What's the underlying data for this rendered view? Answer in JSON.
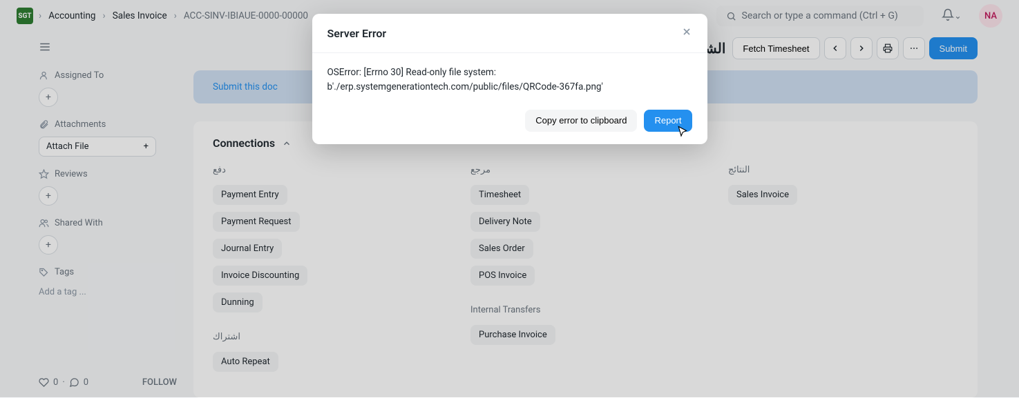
{
  "breadcrumb": {
    "items": [
      "Accounting",
      "Sales Invoice",
      "ACC-SINV-IBIAUE-0000-00000"
    ]
  },
  "search": {
    "placeholder": "Search or type a command (Ctrl + G)"
  },
  "avatar": {
    "initials": "NA"
  },
  "page": {
    "title": "الشركة السعودية الخليجية لحماية البيئة"
  },
  "actions": {
    "fetch_timesheet": "Fetch Timesheet",
    "submit": "Submit"
  },
  "banner": {
    "link_prefix": "Submit this doc"
  },
  "sidebar": {
    "assigned_to": "Assigned To",
    "attachments": "Attachments",
    "attach_file": "Attach File",
    "reviews": "Reviews",
    "shared_with": "Shared With",
    "tags": "Tags",
    "add_tag": "Add a tag ..."
  },
  "footer": {
    "likes": "0",
    "comments": "0",
    "follow": "FOLLOW"
  },
  "connections": {
    "title": "Connections",
    "cols": [
      {
        "title": "دفع",
        "chips": [
          "Payment Entry",
          "Payment Request",
          "Journal Entry",
          "Invoice Discounting",
          "Dunning"
        ],
        "sub": {
          "title": "اشتراك",
          "chips": [
            "Auto Repeat"
          ]
        }
      },
      {
        "title": "مرجع",
        "chips": [
          "Timesheet",
          "Delivery Note",
          "Sales Order",
          "POS Invoice"
        ],
        "sub": {
          "title": "Internal Transfers",
          "chips": [
            "Purchase Invoice"
          ]
        }
      },
      {
        "title": "النتائج",
        "chips": [
          "Sales Invoice"
        ]
      }
    ]
  },
  "modal": {
    "title": "Server Error",
    "line1": "OSError: [Errno 30] Read-only file system:",
    "line2": "b'./erp.systemgenerationtech.com/public/files/QRCode-367fa.png'",
    "copy": "Copy error to clipboard",
    "report": "Report"
  }
}
